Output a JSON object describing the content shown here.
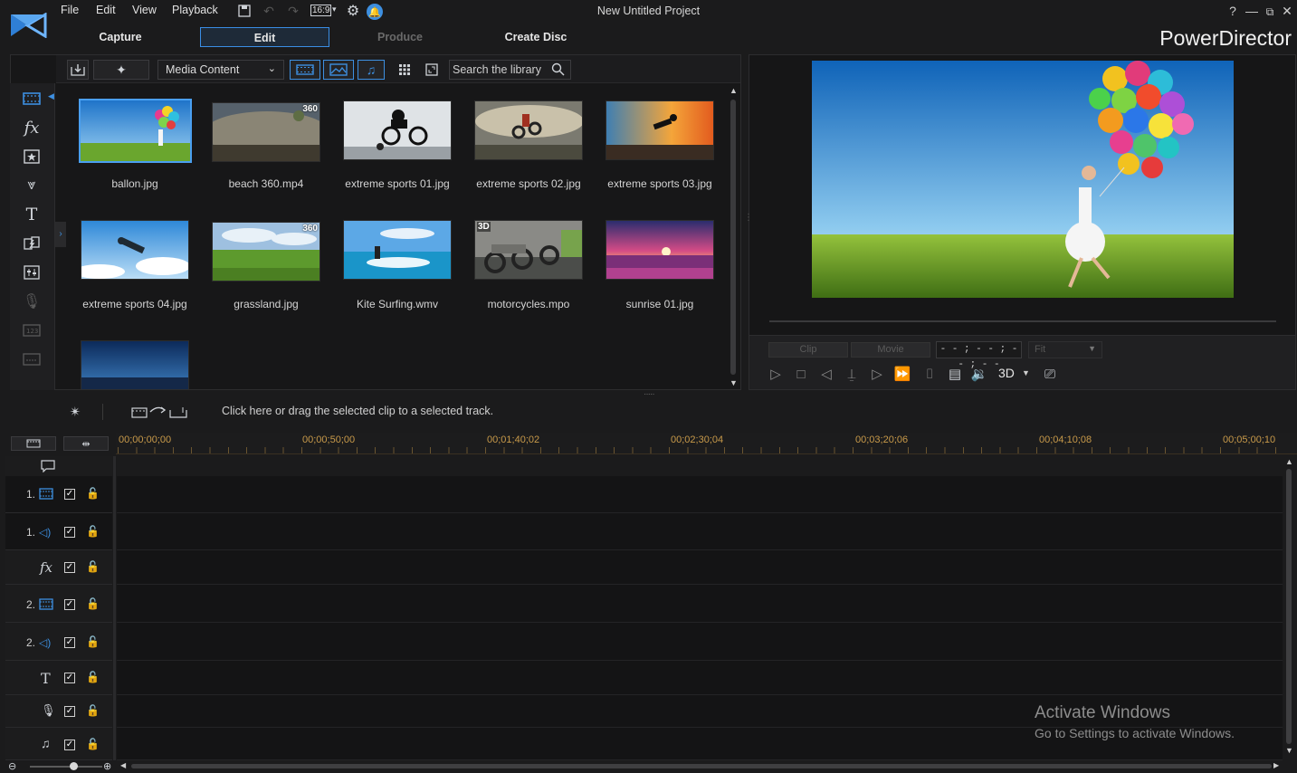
{
  "app": {
    "window_title": "New Untitled Project",
    "brand": "PowerDirector",
    "menus": [
      "File",
      "Edit",
      "View",
      "Playback"
    ],
    "aspect_ratio": "16:9"
  },
  "modes": {
    "capture": "Capture",
    "edit": "Edit",
    "produce": "Produce",
    "create_disc": "Create Disc"
  },
  "library": {
    "dropdown": "Media Content",
    "search_placeholder": "Search the library",
    "items": [
      {
        "name": "ballon.jpg",
        "selected": true,
        "badge": ""
      },
      {
        "name": "beach 360.mp4",
        "badge": "360"
      },
      {
        "name": "extreme sports 01.jpg",
        "badge": ""
      },
      {
        "name": "extreme sports 02.jpg",
        "badge": ""
      },
      {
        "name": "extreme sports 03.jpg",
        "badge": ""
      },
      {
        "name": "extreme sports 04.jpg",
        "badge": ""
      },
      {
        "name": "grassland.jpg",
        "badge": "360"
      },
      {
        "name": "Kite Surfing.wmv",
        "badge": ""
      },
      {
        "name": "motorcycles.mpo",
        "badge": "3D"
      },
      {
        "name": "sunrise 01.jpg",
        "badge": ""
      }
    ]
  },
  "preview": {
    "clip_tab": "Clip",
    "movie_tab": "Movie",
    "timecode": "- - ; - - ; - - ; - -",
    "fit": "Fit",
    "mode_3d": "3D"
  },
  "timeline": {
    "hint": "Click here or drag the selected clip to a selected track.",
    "ticks": [
      "00;00;00;00",
      "00;00;50;00",
      "00;01;40;02",
      "00;02;30;04",
      "00;03;20;06",
      "00;04;10;08",
      "00;05;00;10"
    ],
    "tracks": [
      {
        "num": "1.",
        "kind": "video"
      },
      {
        "num": "1.",
        "kind": "audio"
      },
      {
        "num": "",
        "kind": "fx"
      },
      {
        "num": "2.",
        "kind": "video"
      },
      {
        "num": "2.",
        "kind": "audio"
      },
      {
        "num": "",
        "kind": "title"
      },
      {
        "num": "",
        "kind": "voice"
      },
      {
        "num": "",
        "kind": "music"
      }
    ]
  },
  "watermark": {
    "line1": "Activate Windows",
    "line2": "Go to Settings to activate Windows."
  },
  "colors": {
    "accent": "#3d8fe0",
    "ruler_text": "#c89a4a",
    "background": "#1b1b1c"
  }
}
